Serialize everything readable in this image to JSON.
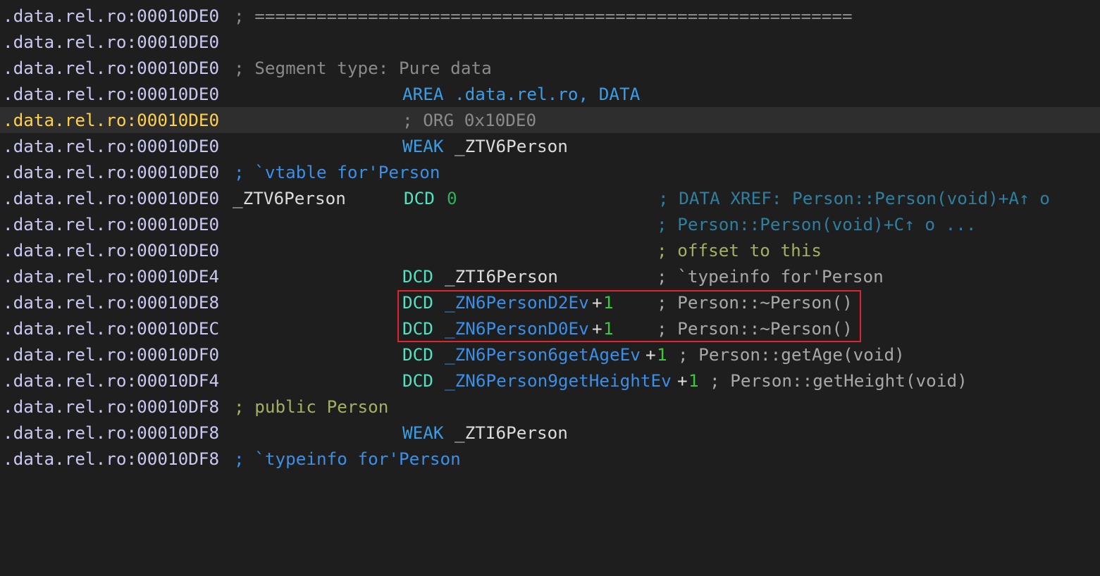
{
  "lines": [
    {
      "addr": ".data.rel.ro:00010DE0",
      "sep": "; =========================================================="
    },
    {
      "addr": ".data.rel.ro:00010DE0"
    },
    {
      "addr": ".data.rel.ro:00010DE0",
      "comment": "; Segment type: Pure data"
    },
    {
      "addr": ".data.rel.ro:00010DE0",
      "kw": "AREA",
      "operand": ".data.rel.ro, DATA"
    },
    {
      "addr": ".data.rel.ro:00010DE0",
      "comment": "; ORG 0x10DE0"
    },
    {
      "addr": ".data.rel.ro:00010DE0",
      "kw": "WEAK",
      "operand": "_ZTV6Person"
    },
    {
      "addr": ".data.rel.ro:00010DE0",
      "comment": "; `vtable for'Person"
    },
    {
      "addr": ".data.rel.ro:00010DE0",
      "label": "_ZTV6Person",
      "kw": "DCD",
      "num": "0",
      "xref": "; DATA XREF: Person::Person(void)+A↑ o"
    },
    {
      "addr": ".data.rel.ro:00010DE0",
      "xref": "; Person::Person(void)+C↑ o ..."
    },
    {
      "addr": ".data.rel.ro:00010DE0",
      "comment": "; offset to this"
    },
    {
      "addr": ".data.rel.ro:00010DE4",
      "kw": "DCD",
      "operand": "_ZTI6Person",
      "comment": "; `typeinfo for'Person"
    },
    {
      "addr": ".data.rel.ro:00010DE8",
      "kw": "DCD",
      "operand": "_ZN6PersonD2Ev",
      "plus": "+",
      "num": "1",
      "comment": "; Person::~Person()"
    },
    {
      "addr": ".data.rel.ro:00010DEC",
      "kw": "DCD",
      "operand": "_ZN6PersonD0Ev",
      "plus": "+",
      "num": "1",
      "comment": "; Person::~Person()"
    },
    {
      "addr": ".data.rel.ro:00010DF0",
      "kw": "DCD",
      "operand": "_ZN6Person6getAgeEv",
      "plus": "+",
      "num": "1",
      "comment": "; Person::getAge(void)"
    },
    {
      "addr": ".data.rel.ro:00010DF4",
      "kw": "DCD",
      "operand": "_ZN6Person9getHeightEv",
      "plus": "+",
      "num": "1",
      "comment": "; Person::getHeight(void)"
    },
    {
      "addr": ".data.rel.ro:00010DF8",
      "comment": "; public Person"
    },
    {
      "addr": ".data.rel.ro:00010DF8",
      "kw": "WEAK",
      "operand": "_ZTI6Person"
    },
    {
      "addr": ".data.rel.ro:00010DF8",
      "comment": "; `typeinfo for'Person"
    }
  ],
  "colors": {
    "background": "#1e1e1e",
    "current_line": "#2e2e2e",
    "highlight_box": "#e0242c"
  }
}
